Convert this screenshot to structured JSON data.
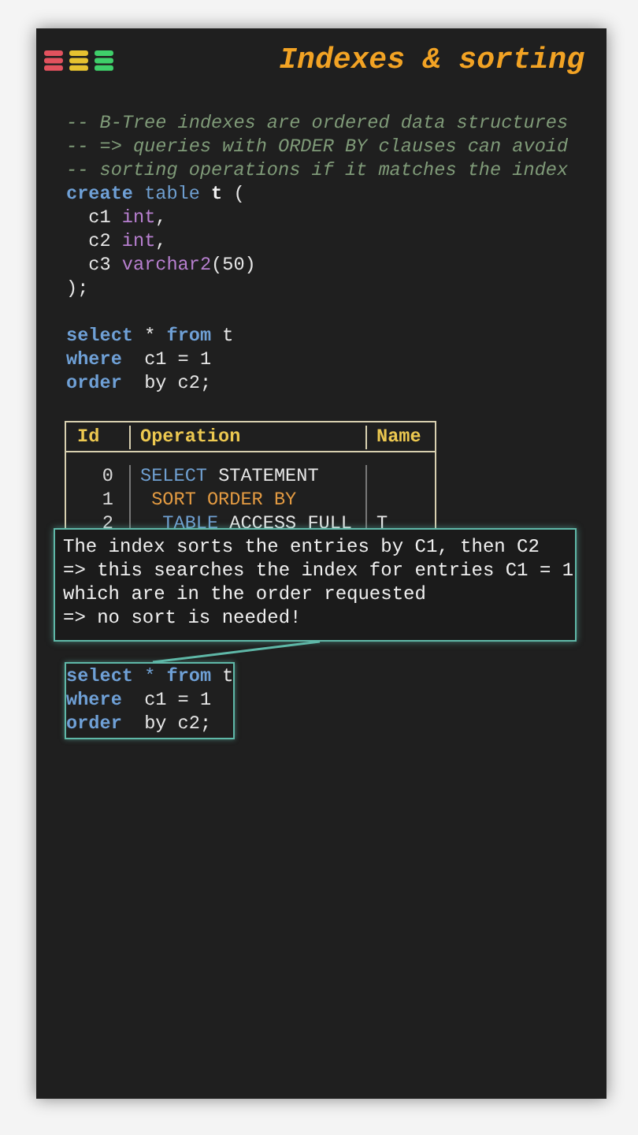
{
  "window_icons": [
    {
      "color": "#e2525e"
    },
    {
      "color": "#e6c230"
    },
    {
      "color": "#3fcf6a"
    }
  ],
  "title": "Indexes & sorting",
  "code": [
    [
      {
        "kind": "comment",
        "text": "-- B-Tree indexes are ordered data structures"
      }
    ],
    [
      {
        "kind": "comment",
        "text": "-- => queries with ORDER BY clauses can avoid"
      }
    ],
    [
      {
        "kind": "comment",
        "text": "-- sorting operations if it matches the index"
      }
    ],
    [
      {
        "kind": "keyword",
        "text": "create"
      },
      {
        "kind": "keyword2",
        "text": " table "
      },
      {
        "kind": "name",
        "text": "t"
      },
      {
        "kind": "plain",
        "text": " ("
      }
    ],
    [
      {
        "kind": "plain",
        "text": "  c1 "
      },
      {
        "kind": "type",
        "text": "int"
      },
      {
        "kind": "plain",
        "text": ","
      }
    ],
    [
      {
        "kind": "plain",
        "text": "  c2 "
      },
      {
        "kind": "type",
        "text": "int"
      },
      {
        "kind": "plain",
        "text": ","
      }
    ],
    [
      {
        "kind": "plain",
        "text": "  c3 "
      },
      {
        "kind": "type",
        "text": "varchar2"
      },
      {
        "kind": "plain",
        "text": "(50)"
      }
    ],
    [
      {
        "kind": "plain",
        "text": ");"
      }
    ]
  ],
  "query": [
    [
      {
        "kind": "keyword",
        "text": "select"
      },
      {
        "kind": "plain",
        "text": " * "
      },
      {
        "kind": "keyword",
        "text": "from"
      },
      {
        "kind": "plain",
        "text": " t"
      }
    ],
    [
      {
        "kind": "keyword",
        "text": "where"
      },
      {
        "kind": "plain",
        "text": "  c1 = 1"
      }
    ],
    [
      {
        "kind": "keyword",
        "text": "order"
      },
      {
        "kind": "plain",
        "text": "  by c2;"
      }
    ]
  ],
  "plan": {
    "columns": [
      "Id",
      "Operation",
      "Name"
    ],
    "rows": [
      {
        "id": "0",
        "operation": [
          {
            "kind": "keyword2",
            "text": "SELECT"
          },
          {
            "kind": "plain",
            "text": " STATEMENT"
          }
        ]
      },
      {
        "id": "1",
        "operation": [
          {
            "kind": "sort",
            "text": " SORT ORDER BY"
          }
        ]
      },
      {
        "id": "2",
        "operation": [
          {
            "kind": "keyword2",
            "text": "  TABLE"
          },
          {
            "kind": "plain",
            "text": " ACCESS FULL"
          }
        ],
        "name": "T"
      }
    ]
  },
  "callout": [
    "The index sorts the entries by C1, then C2",
    "=> this searches the index for entries C1 = 1",
    "which are in the order requested",
    "=> no sort is needed!"
  ],
  "highlighted_query": [
    [
      {
        "kind": "keyword",
        "text": "select"
      },
      {
        "kind": "keyword2",
        "text": " * "
      },
      {
        "kind": "keyword",
        "text": "from"
      },
      {
        "kind": "plain",
        "text": " t"
      }
    ],
    [
      {
        "kind": "keyword",
        "text": "where"
      },
      {
        "kind": "plain",
        "text": "  c1 = 1"
      }
    ],
    [
      {
        "kind": "keyword",
        "text": "order"
      },
      {
        "kind": "plain",
        "text": "  by c2;"
      }
    ]
  ]
}
